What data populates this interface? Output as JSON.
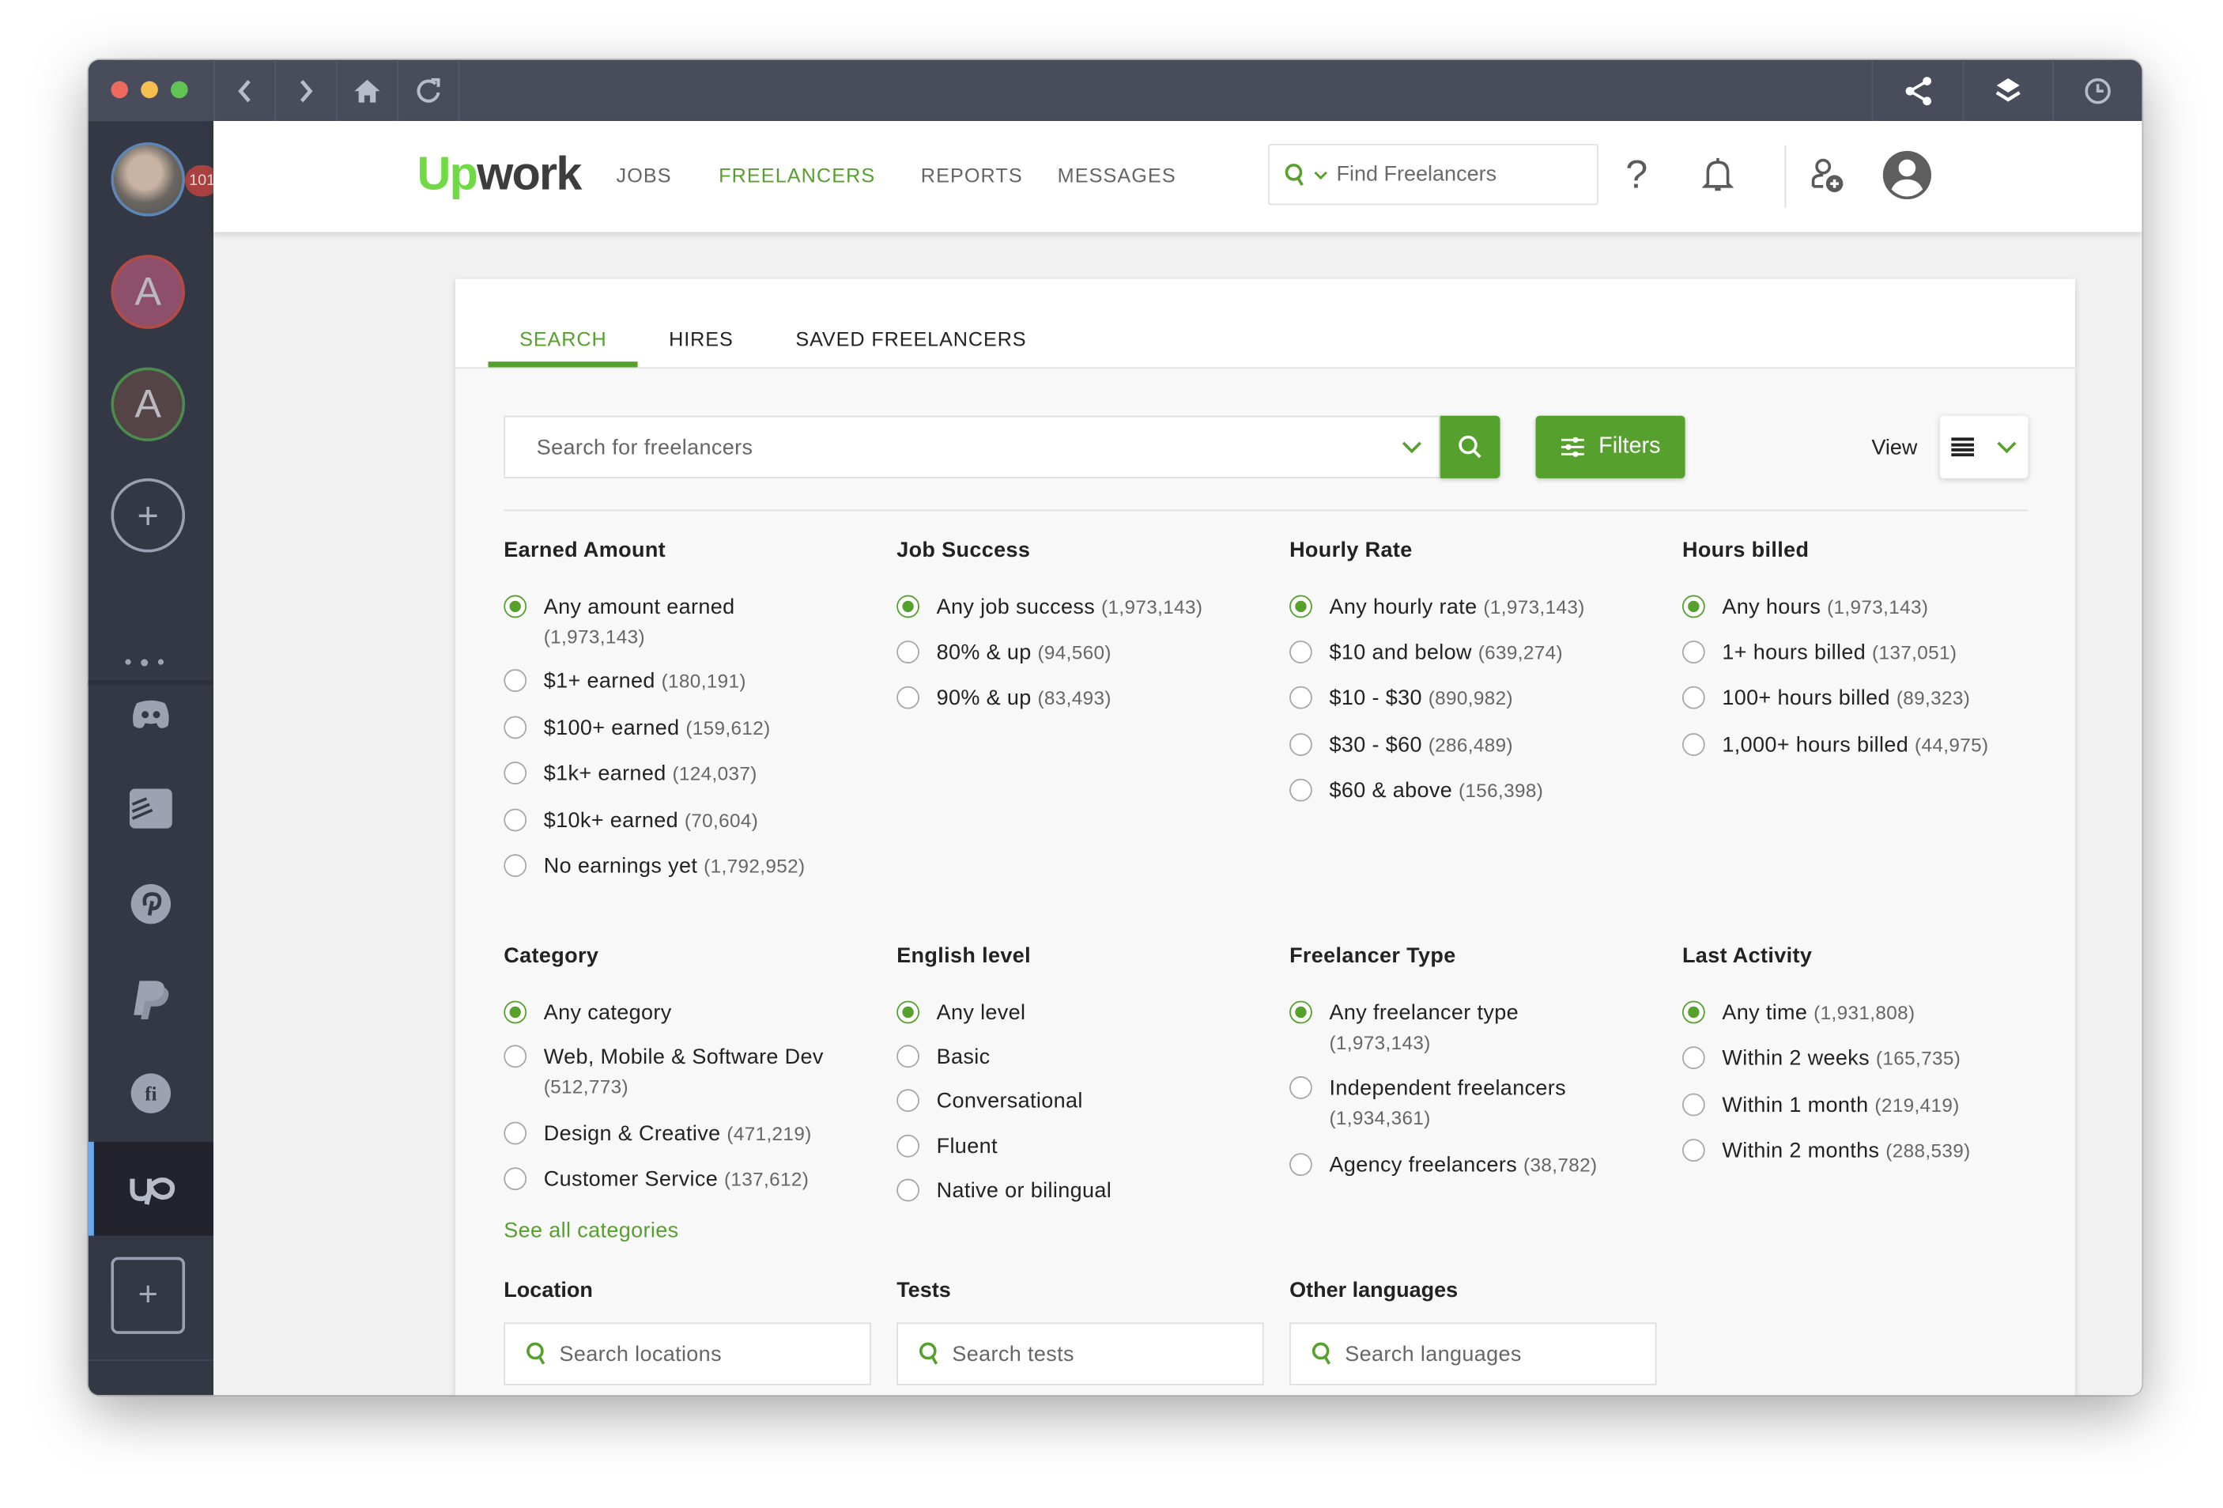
{
  "browser": {
    "traffic_lights": {
      "close": "#ee6a5e",
      "minimize": "#f5bf4f",
      "maximize": "#61c454"
    },
    "nav_icons": [
      "back-icon",
      "forward-icon",
      "home-icon",
      "reload-icon"
    ],
    "right_icons": [
      "share-icon",
      "layers-icon",
      "clock-icon"
    ]
  },
  "sidebar": {
    "profile_badge": "101",
    "accounts": [
      {
        "letter": "A",
        "bg": "#8e4f6a",
        "ring": "#b24b45"
      },
      {
        "letter": "A",
        "bg": "#544446",
        "ring": "#4b8b4e"
      }
    ],
    "apps": [
      "discord-icon",
      "todoist-icon",
      "pinterest-icon",
      "paypal-icon",
      "fiverr-icon",
      "upwork-icon"
    ],
    "active_app": "upwork-icon"
  },
  "header": {
    "logo_up": "Up",
    "logo_work": "work",
    "nav": [
      {
        "label": "JOBS",
        "active": false
      },
      {
        "label": "FREELANCERS",
        "active": true
      },
      {
        "label": "REPORTS",
        "active": false
      },
      {
        "label": "MESSAGES",
        "active": false
      }
    ],
    "find_placeholder": "Find Freelancers"
  },
  "colors": {
    "accent": "#56a02e",
    "logo_green": "#6fda44",
    "topbar": "#494c5b",
    "sidebar": "#343744"
  },
  "tabs": [
    {
      "label": "SEARCH",
      "active": true
    },
    {
      "label": "HIRES",
      "active": false
    },
    {
      "label": "SAVED FREELANCERS",
      "active": false
    }
  ],
  "search": {
    "placeholder": "Search for freelancers",
    "filters_label": "Filters",
    "view_label": "View"
  },
  "filters": [
    {
      "title": "Earned Amount",
      "options": [
        {
          "label": "Any amount earned",
          "count": "(1,973,143)",
          "selected": true,
          "wrap": true
        },
        {
          "label": "$1+ earned",
          "count": "(180,191)",
          "selected": false
        },
        {
          "label": "$100+ earned",
          "count": "(159,612)",
          "selected": false
        },
        {
          "label": "$1k+ earned",
          "count": "(124,037)",
          "selected": false
        },
        {
          "label": "$10k+ earned",
          "count": "(70,604)",
          "selected": false
        },
        {
          "label": "No earnings yet",
          "count": "(1,792,952)",
          "selected": false
        }
      ]
    },
    {
      "title": "Job Success",
      "options": [
        {
          "label": "Any job success",
          "count": "(1,973,143)",
          "selected": true
        },
        {
          "label": "80% & up",
          "count": "(94,560)",
          "selected": false
        },
        {
          "label": "90% & up",
          "count": "(83,493)",
          "selected": false
        }
      ]
    },
    {
      "title": "Hourly Rate",
      "options": [
        {
          "label": "Any hourly rate",
          "count": "(1,973,143)",
          "selected": true
        },
        {
          "label": "$10 and below",
          "count": "(639,274)",
          "selected": false
        },
        {
          "label": "$10 - $30",
          "count": "(890,982)",
          "selected": false
        },
        {
          "label": "$30 - $60",
          "count": "(286,489)",
          "selected": false
        },
        {
          "label": "$60 & above",
          "count": "(156,398)",
          "selected": false
        }
      ]
    },
    {
      "title": "Hours billed",
      "options": [
        {
          "label": "Any hours",
          "count": "(1,973,143)",
          "selected": true
        },
        {
          "label": "1+ hours billed",
          "count": "(137,051)",
          "selected": false
        },
        {
          "label": "100+ hours billed",
          "count": "(89,323)",
          "selected": false
        },
        {
          "label": "1,000+ hours billed",
          "count": "(44,975)",
          "selected": false
        }
      ]
    },
    {
      "title": "Category",
      "options": [
        {
          "label": "Any category",
          "count": "",
          "selected": true
        },
        {
          "label": "Web, Mobile & Software Dev",
          "count": "(512,773)",
          "selected": false,
          "wrap": true
        },
        {
          "label": "Design & Creative",
          "count": "(471,219)",
          "selected": false
        },
        {
          "label": "Customer Service",
          "count": "(137,612)",
          "selected": false
        }
      ]
    },
    {
      "title": "English level",
      "options": [
        {
          "label": "Any level",
          "count": "",
          "selected": true
        },
        {
          "label": "Basic",
          "count": "",
          "selected": false
        },
        {
          "label": "Conversational",
          "count": "",
          "selected": false
        },
        {
          "label": "Fluent",
          "count": "",
          "selected": false
        },
        {
          "label": "Native or bilingual",
          "count": "",
          "selected": false
        }
      ]
    },
    {
      "title": "Freelancer Type",
      "options": [
        {
          "label": "Any freelancer type",
          "count": "(1,973,143)",
          "selected": true,
          "wrap": true
        },
        {
          "label": "Independent freelancers",
          "count": "(1,934,361)",
          "selected": false,
          "wrap": true
        },
        {
          "label": "Agency freelancers",
          "count": "(38,782)",
          "selected": false
        }
      ]
    },
    {
      "title": "Last Activity",
      "options": [
        {
          "label": "Any time",
          "count": "(1,931,808)",
          "selected": true
        },
        {
          "label": "Within 2 weeks",
          "count": "(165,735)",
          "selected": false
        },
        {
          "label": "Within 1 month",
          "count": "(219,419)",
          "selected": false
        },
        {
          "label": "Within 2 months",
          "count": "(288,539)",
          "selected": false
        }
      ]
    }
  ],
  "see_all_categories": "See all categories",
  "bottom_sections": [
    {
      "title": "Location",
      "placeholder": "Search locations"
    },
    {
      "title": "Tests",
      "placeholder": "Search tests"
    },
    {
      "title": "Other languages",
      "placeholder": "Search languages"
    }
  ]
}
